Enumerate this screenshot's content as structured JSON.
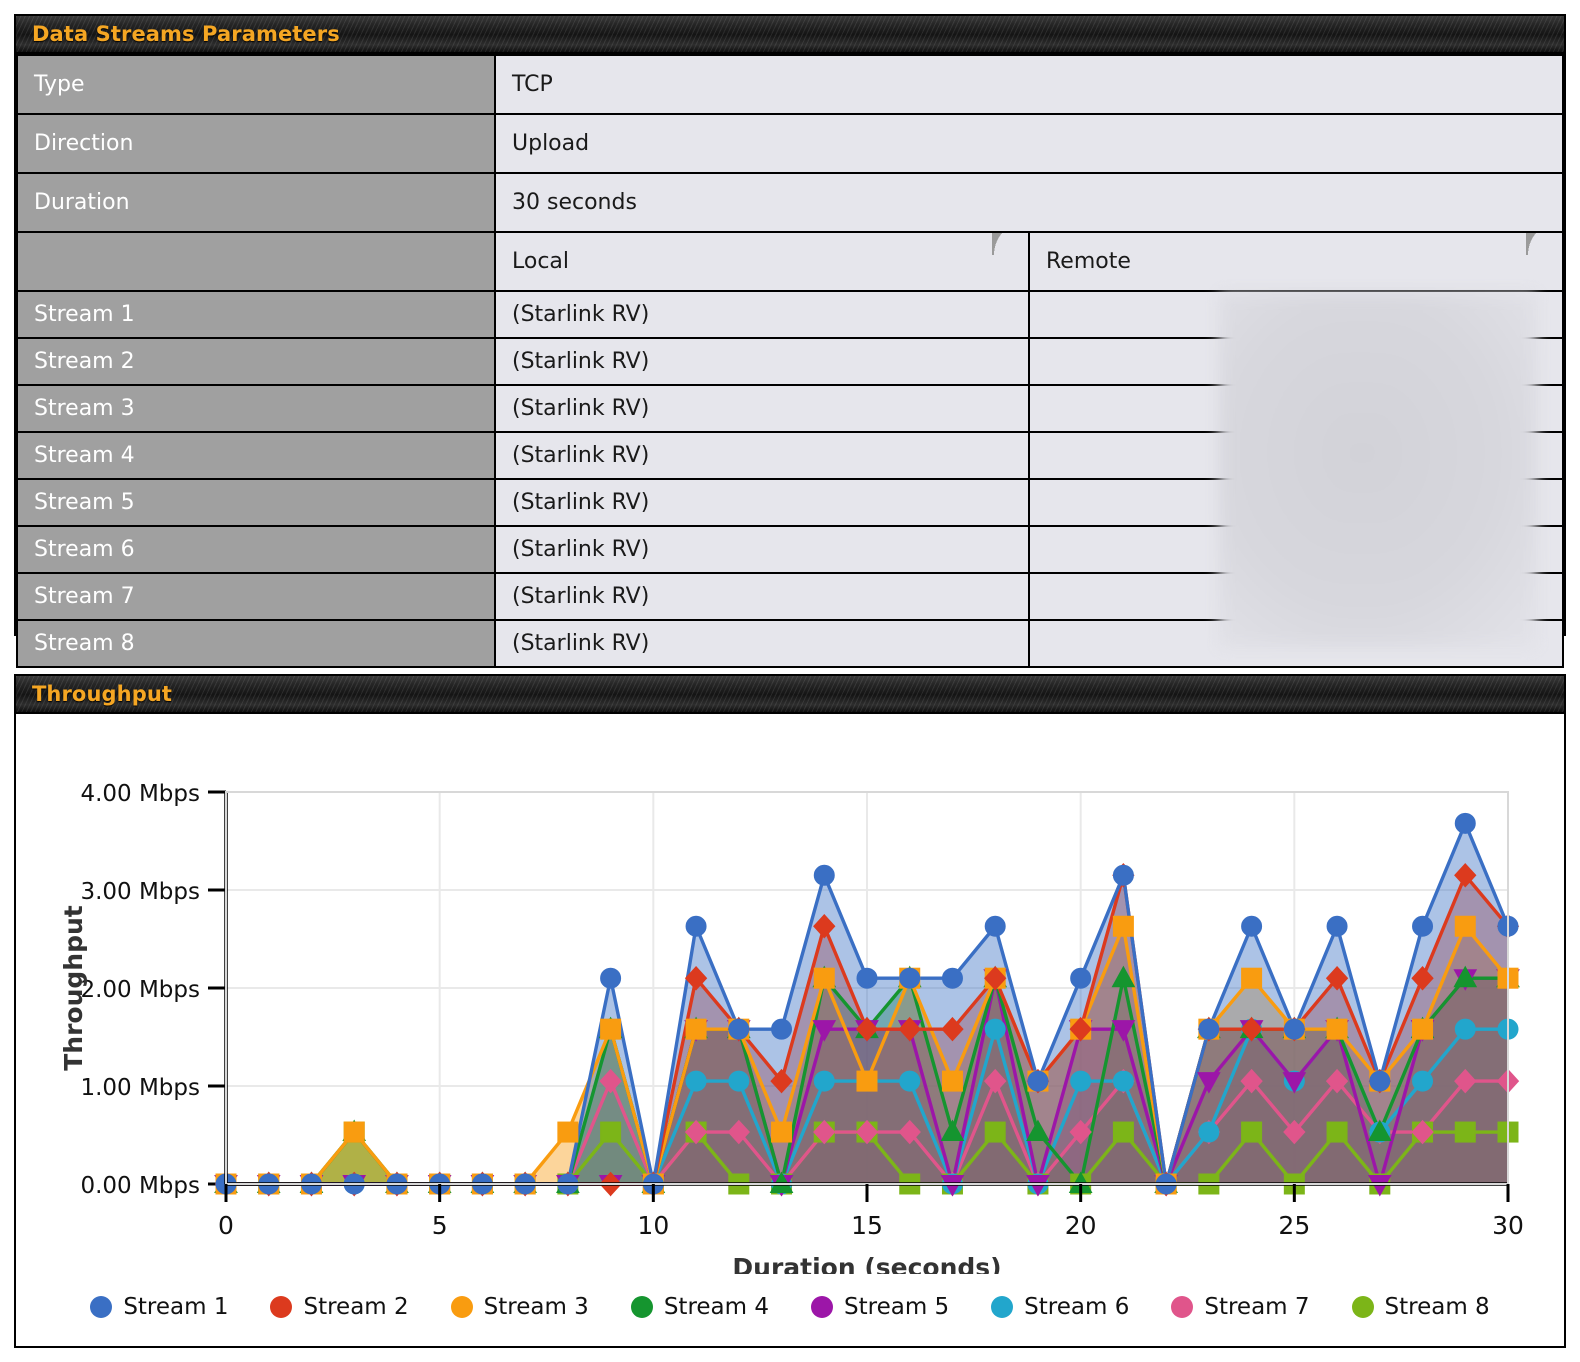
{
  "params": {
    "header_title": "Data Streams Parameters",
    "rows": [
      {
        "label": "Type",
        "value": "TCP"
      },
      {
        "label": "Direction",
        "value": "Upload"
      },
      {
        "label": "Duration",
        "value": "30 seconds"
      }
    ],
    "column_headers": {
      "blank": "",
      "local": "Local",
      "remote": "Remote"
    },
    "streams": [
      {
        "label": "Stream 1",
        "local": "(Starlink RV)",
        "remote": ""
      },
      {
        "label": "Stream 2",
        "local": "(Starlink RV)",
        "remote": ""
      },
      {
        "label": "Stream 3",
        "local": "(Starlink RV)",
        "remote": ""
      },
      {
        "label": "Stream 4",
        "local": "(Starlink RV)",
        "remote": ""
      },
      {
        "label": "Stream 5",
        "local": "(Starlink RV)",
        "remote": ""
      },
      {
        "label": "Stream 6",
        "local": "(Starlink RV)",
        "remote": ""
      },
      {
        "label": "Stream 7",
        "local": "(Starlink RV)",
        "remote": ""
      },
      {
        "label": "Stream 8",
        "local": "(Starlink RV)",
        "remote": ""
      }
    ]
  },
  "chart_panel": {
    "header_title": "Throughput"
  },
  "chart_data": {
    "type": "area",
    "title": "Throughput",
    "xlabel": "Duration (seconds)",
    "ylabel": "Throughput",
    "xlim": [
      0,
      30
    ],
    "ylim": [
      0,
      4
    ],
    "xticks": [
      0,
      5,
      10,
      15,
      20,
      25,
      30
    ],
    "ytick_labels": [
      "0.00 Mbps",
      "1.00 Mbps",
      "2.00 Mbps",
      "3.00 Mbps",
      "4.00 Mbps"
    ],
    "yticks": [
      0,
      1,
      2,
      3,
      4
    ],
    "grid": true,
    "legend_position": "bottom",
    "unit": "Mbps",
    "x": [
      0,
      1,
      2,
      3,
      4,
      5,
      6,
      7,
      8,
      9,
      10,
      11,
      12,
      13,
      14,
      15,
      16,
      17,
      18,
      19,
      20,
      21,
      22,
      23,
      24,
      25,
      26,
      27,
      28,
      29,
      30
    ],
    "series": [
      {
        "name": "Stream 1",
        "color": "#3a6fc4",
        "marker": "circle",
        "values": [
          0,
          0,
          0,
          0,
          0,
          0,
          0,
          0,
          0,
          2.1,
          0,
          2.63,
          1.58,
          1.58,
          3.15,
          2.1,
          2.1,
          2.1,
          2.63,
          1.05,
          2.1,
          3.15,
          0,
          1.58,
          2.63,
          1.58,
          2.63,
          1.05,
          2.63,
          3.68,
          2.63
        ]
      },
      {
        "name": "Stream 2",
        "color": "#dc3a1e",
        "marker": "diamond",
        "values": [
          0,
          0,
          0,
          0,
          0,
          0,
          0,
          0,
          0,
          0,
          0,
          2.1,
          1.58,
          1.05,
          2.63,
          1.58,
          1.58,
          1.58,
          2.1,
          1.05,
          1.58,
          3.15,
          0,
          1.58,
          1.58,
          1.58,
          2.1,
          1.05,
          2.1,
          3.15,
          2.63
        ]
      },
      {
        "name": "Stream 3",
        "color": "#f99c10",
        "marker": "square",
        "values": [
          0,
          0,
          0,
          0.53,
          0,
          0,
          0,
          0,
          0.53,
          1.58,
          0,
          1.58,
          1.58,
          0.53,
          2.1,
          1.05,
          2.1,
          1.05,
          2.1,
          1.05,
          1.58,
          2.63,
          0,
          1.58,
          2.1,
          1.58,
          1.58,
          1.05,
          1.58,
          2.63,
          2.1
        ]
      },
      {
        "name": "Stream 4",
        "color": "#15952f",
        "marker": "triangle-up",
        "values": [
          0,
          0,
          0,
          0.53,
          0,
          0,
          0,
          0,
          0,
          1.58,
          0,
          1.58,
          1.58,
          0,
          2.1,
          1.58,
          2.1,
          0.53,
          2.1,
          0.53,
          0,
          2.1,
          0,
          1.58,
          1.58,
          1.58,
          1.58,
          0.53,
          1.58,
          2.1,
          2.1
        ]
      },
      {
        "name": "Stream 5",
        "color": "#9c16a8",
        "marker": "triangle-down",
        "values": [
          0,
          0,
          0,
          0,
          0,
          0,
          0,
          0,
          0,
          0,
          0,
          1.58,
          1.58,
          0,
          1.58,
          1.58,
          1.58,
          0,
          2.1,
          0,
          1.58,
          1.58,
          0,
          1.05,
          1.58,
          1.05,
          1.58,
          0,
          1.58,
          2.1,
          2.1
        ]
      },
      {
        "name": "Stream 6",
        "color": "#22a6cc",
        "marker": "circle",
        "values": [
          0,
          0,
          0,
          0,
          0,
          0,
          0,
          0,
          0,
          1.58,
          0,
          1.05,
          1.05,
          0,
          1.05,
          1.05,
          1.05,
          0,
          1.58,
          0,
          1.05,
          1.05,
          0,
          0.53,
          1.58,
          1.05,
          1.58,
          0.53,
          1.05,
          1.58,
          1.58
        ]
      },
      {
        "name": "Stream 7",
        "color": "#e0558b",
        "marker": "diamond",
        "values": [
          0,
          0,
          0,
          0,
          0,
          0,
          0,
          0,
          0,
          1.05,
          0,
          0.53,
          0.53,
          0,
          0.53,
          0.53,
          0.53,
          0,
          1.05,
          0,
          0.53,
          1.05,
          0,
          0.53,
          1.05,
          0.53,
          1.05,
          0.53,
          0.53,
          1.05,
          1.05
        ]
      },
      {
        "name": "Stream 8",
        "color": "#7cb518",
        "marker": "square",
        "values": [
          0,
          0,
          0,
          0.53,
          0,
          0,
          0,
          0,
          0,
          0.53,
          0,
          0.53,
          0,
          0,
          0.53,
          0.53,
          0,
          0,
          0.53,
          0,
          0,
          0.53,
          0,
          0,
          0.53,
          0,
          0.53,
          0,
          0.53,
          0.53,
          0.53
        ]
      }
    ]
  }
}
